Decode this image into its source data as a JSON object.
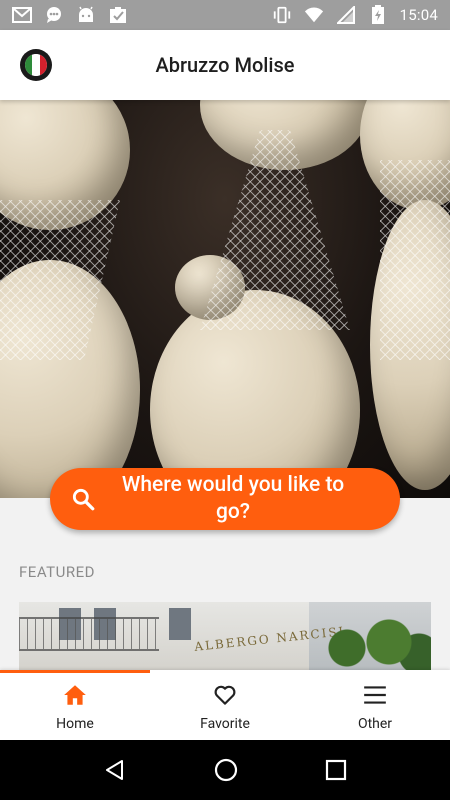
{
  "status_bar": {
    "time": "15:04",
    "left_icons": [
      "gmail-icon",
      "chat-icon",
      "android-icon",
      "clipboard-icon"
    ],
    "right_icons": [
      "vibrate-icon",
      "wifi-icon",
      "signal-icon",
      "battery-charging-icon"
    ]
  },
  "app_bar": {
    "title": "Abruzzo Molise",
    "logo_icon": "italy-flag-logo-icon"
  },
  "search": {
    "label": "Where would you like to go?",
    "icon": "search-icon",
    "color": "#ff5e0e"
  },
  "featured": {
    "label": "FEATURED",
    "card_sign": "ALBERGO NARCISI"
  },
  "bottom_nav": {
    "active_color": "#ff5e0e",
    "items": [
      {
        "label": "Home",
        "icon": "home-icon",
        "active": true
      },
      {
        "label": "Favorite",
        "icon": "heart-icon",
        "active": false
      },
      {
        "label": "Other",
        "icon": "menu-icon",
        "active": false
      }
    ]
  },
  "android_nav": {
    "buttons": [
      "back-icon",
      "home-circle-icon",
      "recents-icon"
    ]
  }
}
